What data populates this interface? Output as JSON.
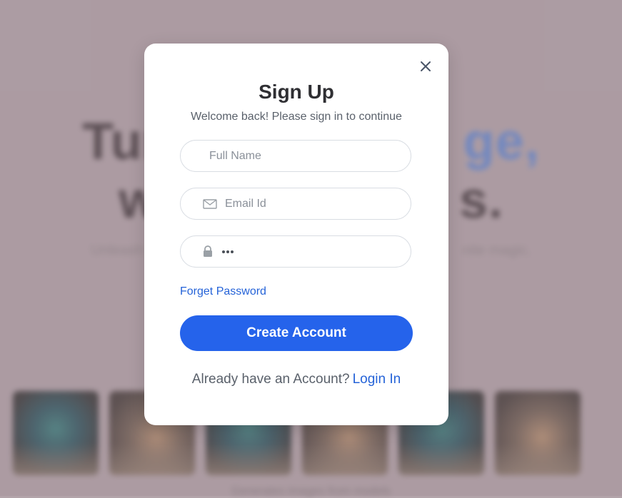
{
  "background": {
    "hero_line1": "Tur",
    "hero_line1_accent": "ge,",
    "hero_line2": "w",
    "hero_line2_end": "s.",
    "subtitle_start": "Unleash yo",
    "subtitle_end": "nite magic.",
    "caption": "Generates images from models",
    "thumbnails": [
      "thumb-1",
      "thumb-2",
      "thumb-3",
      "thumb-4",
      "thumb-5",
      "thumb-6"
    ]
  },
  "modal": {
    "title": "Sign Up",
    "subtitle": "Welcome back! Please sign in to continue",
    "full_name_placeholder": "Full Name",
    "email_placeholder": "Email Id",
    "password_value_masked": "•••",
    "forget_password": "Forget Password",
    "create_button": "Create Account",
    "footer_text": "Already have an Account?",
    "login_link": "Login In",
    "close_icon": "close-icon",
    "email_icon": "mail-icon",
    "password_icon": "lock-icon"
  },
  "colors": {
    "accent": "#2563eb",
    "link": "#2563d8",
    "backdrop": "#b3a4aa"
  }
}
